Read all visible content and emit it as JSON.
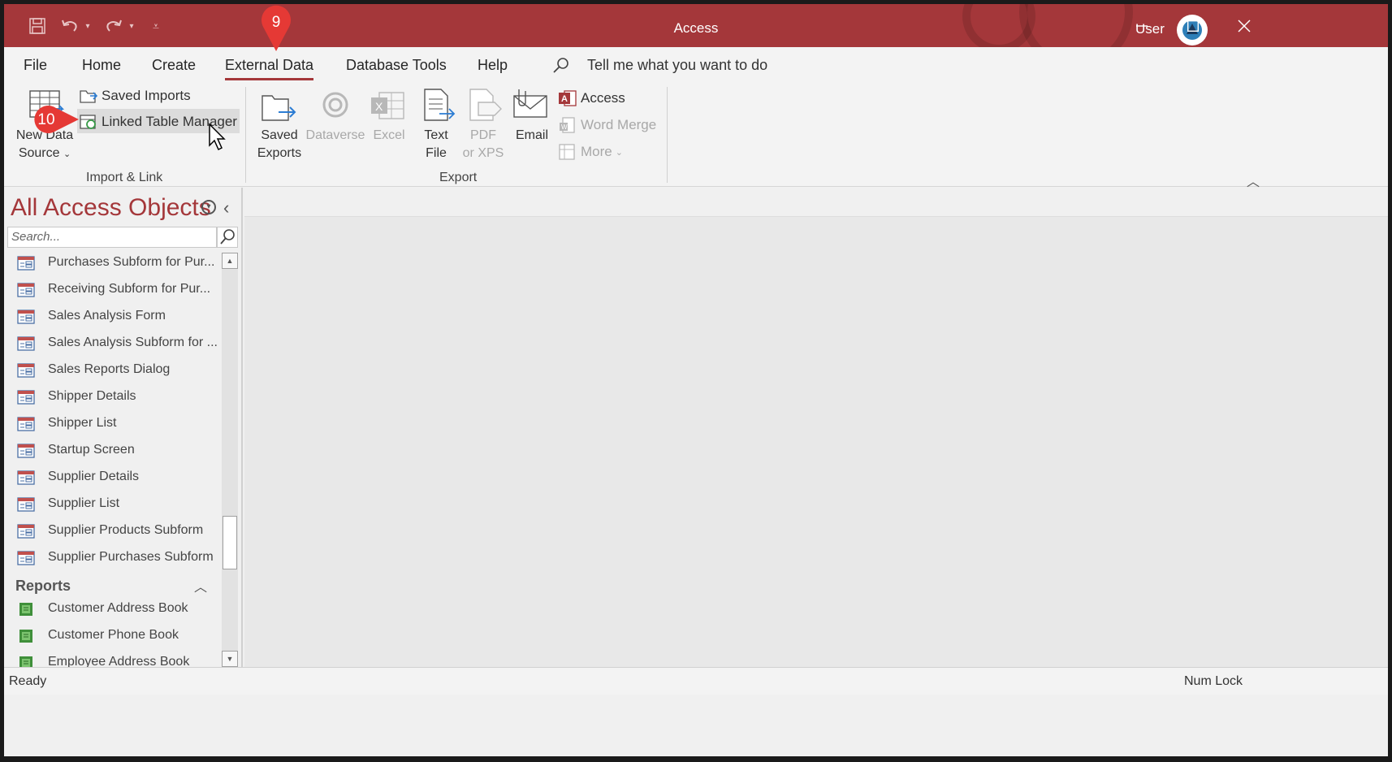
{
  "window": {
    "title": "Access",
    "user_label": "User",
    "accent_color": "#a4373a"
  },
  "quick_access": [
    "save-icon",
    "undo-icon",
    "redo-icon",
    "customize-icon"
  ],
  "tabs": [
    {
      "label": "File"
    },
    {
      "label": "Home"
    },
    {
      "label": "Create"
    },
    {
      "label": "External Data",
      "active": true
    },
    {
      "label": "Database Tools"
    },
    {
      "label": "Help"
    }
  ],
  "tell_me": "Tell me what you want to do",
  "ribbon": {
    "import_link": {
      "group_label": "Import & Link",
      "new_data_source": "New Data Source",
      "new_data_line1": "New Data",
      "new_data_line2": "Source",
      "saved_imports": "Saved Imports",
      "linked_table_manager": "Linked Table Manager"
    },
    "export": {
      "group_label": "Export",
      "saved_exports_1": "Saved",
      "saved_exports_2": "Exports",
      "dataverse": "Dataverse",
      "excel": "Excel",
      "text_file_1": "Text",
      "text_file_2": "File",
      "pdf_1": "PDF",
      "pdf_2": "or XPS",
      "email": "Email",
      "access": "Access",
      "word_merge": "Word Merge",
      "more": "More"
    }
  },
  "nav": {
    "title": "All Access Objects",
    "search_placeholder": "Search...",
    "forms": [
      "Purchases Subform for Pur...",
      "Receiving Subform for Pur...",
      "Sales Analysis Form",
      "Sales Analysis Subform for ...",
      "Sales Reports Dialog",
      "Shipper Details",
      "Shipper List",
      "Startup Screen",
      "Supplier Details",
      "Supplier List",
      "Supplier Products Subform",
      "Supplier Purchases Subform"
    ],
    "reports_header": "Reports",
    "reports": [
      "Customer Address Book",
      "Customer Phone Book",
      "Employee Address Book"
    ]
  },
  "status": {
    "left": "Ready",
    "right": "Num Lock"
  },
  "callouts": {
    "step9": "9",
    "step10": "10",
    "color": "#e53935"
  }
}
